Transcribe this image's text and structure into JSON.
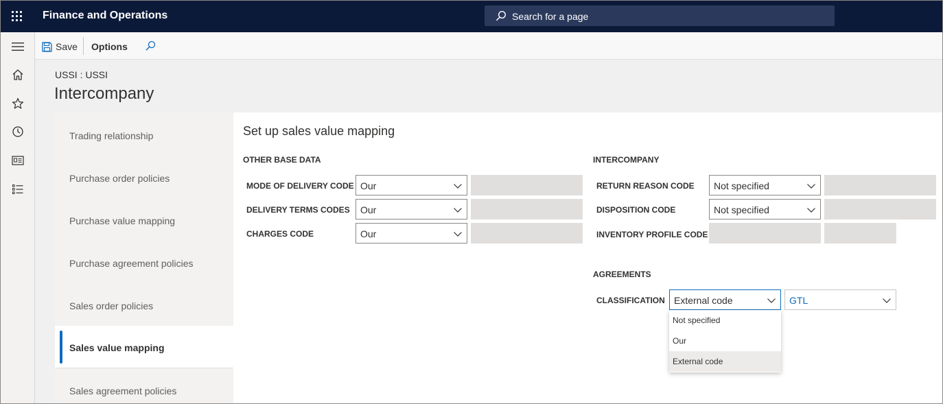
{
  "app": {
    "title": "Finance and Operations"
  },
  "search": {
    "placeholder": "Search for a page"
  },
  "actions": {
    "save_label": "Save",
    "options_label": "Options"
  },
  "header": {
    "breadcrumb": "USSI : USSI",
    "title": "Intercompany"
  },
  "tabs": [
    {
      "label": "Trading relationship"
    },
    {
      "label": "Purchase order policies"
    },
    {
      "label": "Purchase value mapping"
    },
    {
      "label": "Purchase agreement policies"
    },
    {
      "label": "Sales order policies"
    },
    {
      "label": "Sales value mapping",
      "active": true
    },
    {
      "label": "Sales agreement policies"
    }
  ],
  "content": {
    "title": "Set up sales value mapping",
    "other_base_data": {
      "header": "OTHER BASE DATA",
      "fields": [
        {
          "label": "MODE OF DELIVERY CODE",
          "value": "Our"
        },
        {
          "label": "DELIVERY TERMS CODES",
          "value": "Our"
        },
        {
          "label": "CHARGES CODE",
          "value": "Our"
        }
      ]
    },
    "intercompany": {
      "header": "INTERCOMPANY",
      "fields": [
        {
          "label": "RETURN REASON CODE",
          "value": "Not specified"
        },
        {
          "label": "DISPOSITION CODE",
          "value": "Not specified"
        },
        {
          "label": "INVENTORY PROFILE CODE",
          "value": ""
        }
      ]
    },
    "agreements": {
      "header": "AGREEMENTS",
      "classification_label": "CLASSIFICATION",
      "classification_value": "External code",
      "code_value": "GTL",
      "dropdown_options": [
        "Not specified",
        "Our",
        "External code"
      ],
      "selected_option": "External code"
    }
  },
  "colors": {
    "topbar": "#0c1a3a",
    "accent": "#0f6cbd",
    "readonly": "#e1dfdd"
  },
  "icons": {
    "waffle": "app-launcher-icon",
    "search": "search-icon",
    "menu": "hamburger-icon",
    "home": "home-icon",
    "favorites": "star-icon",
    "recent": "clock-icon",
    "workspaces": "workspace-icon",
    "modules": "list-icon",
    "save": "save-icon",
    "find": "find-icon",
    "dropdown": "chevron-down-icon"
  }
}
